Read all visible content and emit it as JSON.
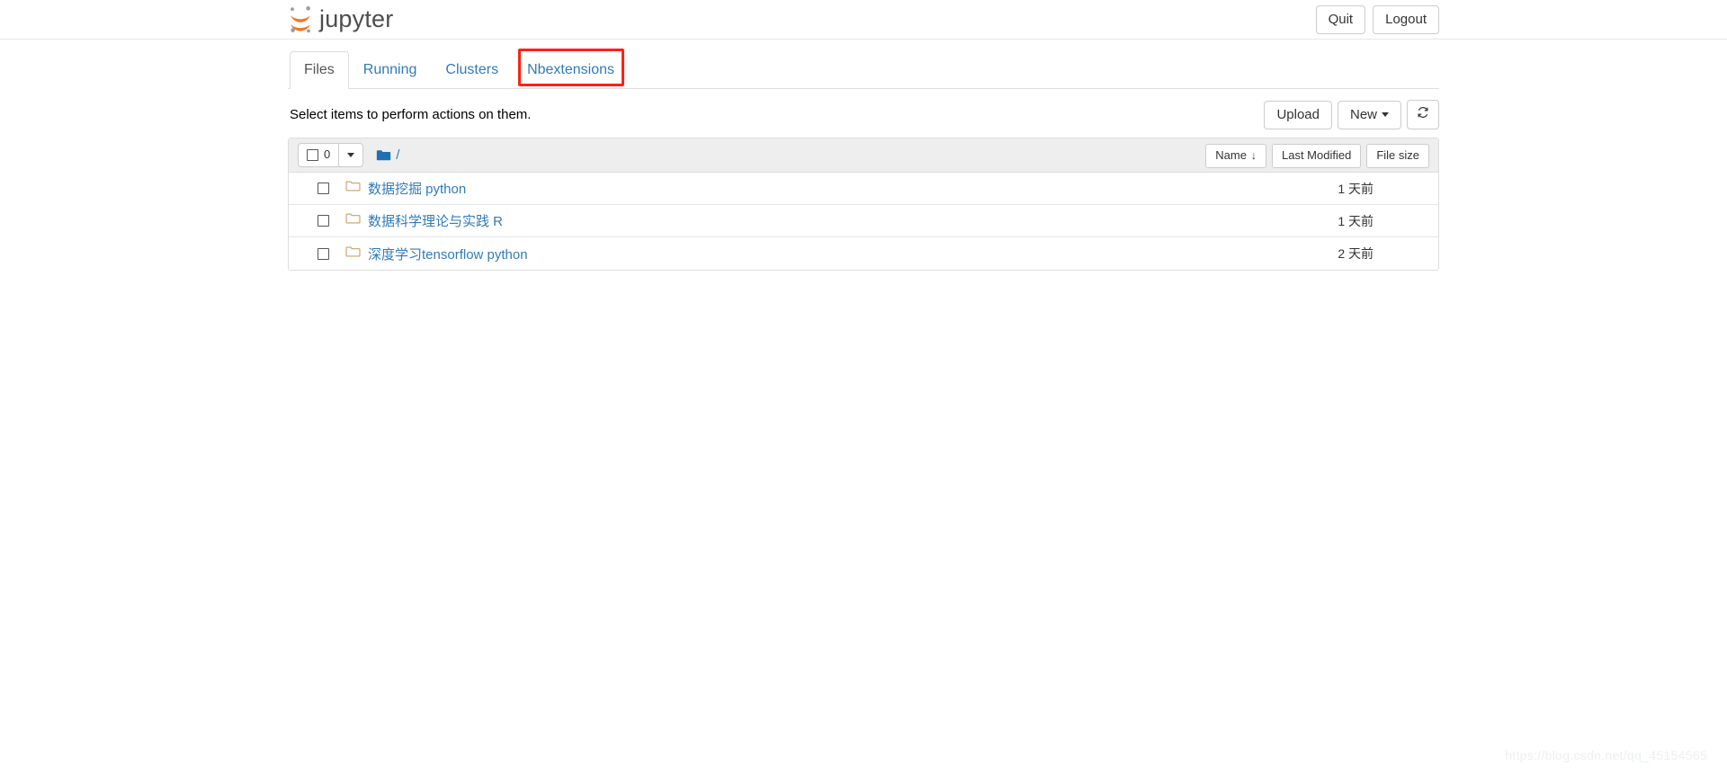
{
  "header": {
    "brand_text": "jupyter",
    "logo_icon": "jupyter-logo",
    "quit_label": "Quit",
    "logout_label": "Logout"
  },
  "tabs": [
    {
      "label": "Files",
      "active": true
    },
    {
      "label": "Running",
      "active": false
    },
    {
      "label": "Clusters",
      "active": false
    },
    {
      "label": "Nbextensions",
      "active": false,
      "highlighted": true
    }
  ],
  "toolbar": {
    "note": "Select items to perform actions on them.",
    "upload_label": "Upload",
    "new_label": "New",
    "new_caret_icon": "chevron-down-icon",
    "refresh_icon": "refresh-icon",
    "refresh_glyph": "↻"
  },
  "list_header": {
    "select_all_checkbox": "checkbox-unchecked-icon",
    "selected_count": "0",
    "select_caret_icon": "chevron-down-icon",
    "breadcrumb_folder_icon": "folder-solid-icon",
    "breadcrumb_root": "/",
    "sort_name": "Name",
    "sort_name_arrow": "↓",
    "sort_last_modified": "Last Modified",
    "sort_file_size": "File size"
  },
  "files": [
    {
      "checkbox": "checkbox-unchecked-icon",
      "icon": "folder-outline-icon",
      "name": "数据挖掘 python",
      "modified": "1 天前"
    },
    {
      "checkbox": "checkbox-unchecked-icon",
      "icon": "folder-outline-icon",
      "name": "数据科学理论与实践 R",
      "modified": "1 天前"
    },
    {
      "checkbox": "checkbox-unchecked-icon",
      "icon": "folder-outline-icon",
      "name": "深度学习tensorflow python",
      "modified": "2 天前"
    }
  ],
  "watermark": {
    "text": "https://blog.csdn.net/qq_45154565"
  },
  "colors": {
    "link": "#337ab7",
    "brand_orange": "#f37726",
    "brand_gray": "#9e9e9e",
    "highlight_red": "#ff2016",
    "header_bg": "#eeeeee"
  }
}
